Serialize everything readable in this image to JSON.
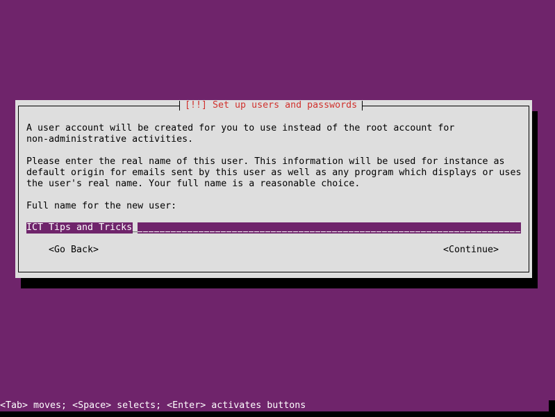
{
  "dialog": {
    "title": "[!!] Set up users and passwords",
    "paragraph1": [
      "A user account will be created for you to use instead of the root account for",
      "non-administrative activities."
    ],
    "paragraph2": [
      "Please enter the real name of this user. This information will be used for instance as",
      "default origin for emails sent by this user as well as any program which displays or uses",
      "the user's real name. Your full name is a reasonable choice."
    ],
    "field_label": "Full name for the new user:",
    "field_value": "ICT Tips and Tricks",
    "buttons": {
      "back": "<Go Back>",
      "continue": "<Continue>"
    }
  },
  "status_bar": "<Tab> moves; <Space> selects; <Enter> activates buttons",
  "colors": {
    "background": "#6f246b",
    "dialog": "#dedede",
    "title": "#d0312d",
    "shadow": "#000000"
  }
}
